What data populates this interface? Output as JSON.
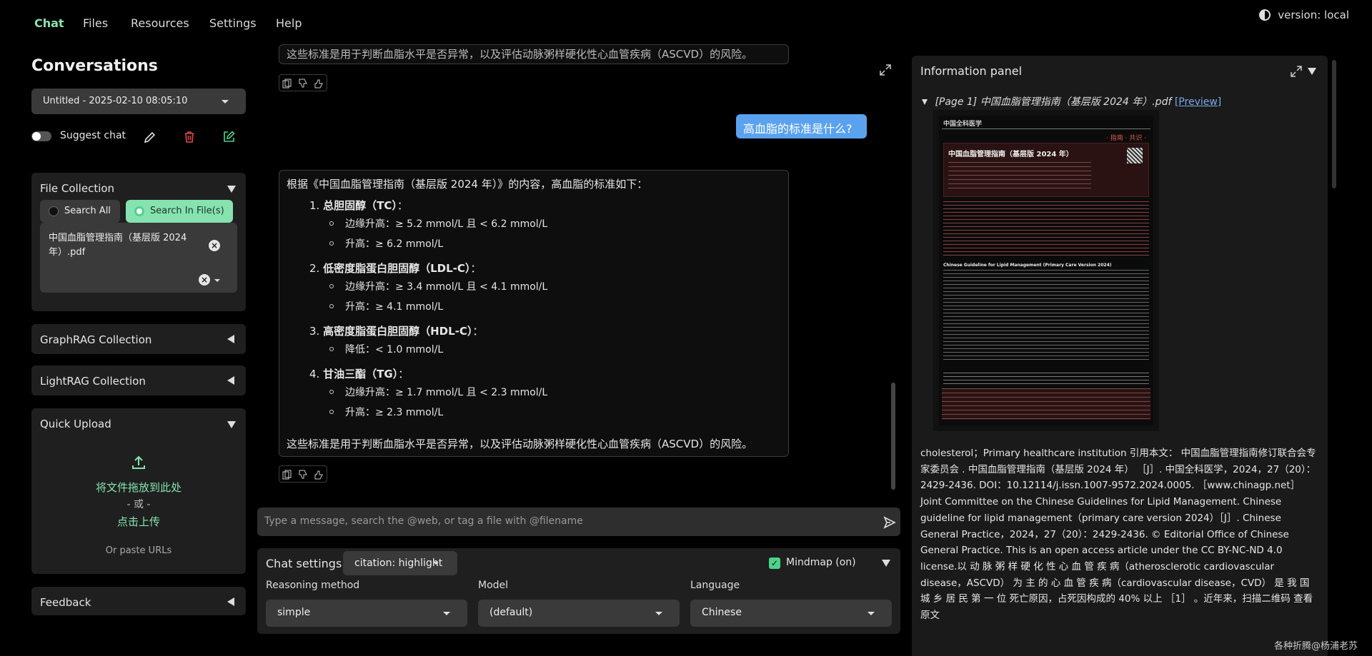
{
  "nav": {
    "items": [
      "Chat",
      "Files",
      "Resources",
      "Settings",
      "Help"
    ],
    "version": "version: local"
  },
  "sidebar": {
    "title": "Conversations",
    "conversation": "Untitled - 2025-02-10 08:05:10",
    "suggest_chat": "Suggest chat",
    "file_collection": {
      "title": "File Collection",
      "search_all": "Search All",
      "search_in_files": "Search In File(s)",
      "selected_file": "中国血脂管理指南（基层版 2024 年）.pdf"
    },
    "graphrag": "GraphRAG Collection",
    "lightrag": "LightRAG Collection",
    "quick_upload": {
      "title": "Quick Upload",
      "drop_text": "将文件拖放到此处",
      "or_text": "- 或 -",
      "click_upload": "点击上传",
      "paste_urls": "Or paste URLs"
    },
    "feedback": "Feedback"
  },
  "chat": {
    "previous_tail": "这些标准是用于判断血脂水平是否异常，以及评估动脉粥样硬化性心血管疾病（ASCVD）的风险。",
    "user_message": "高血脂的标准是什么?",
    "answer": {
      "intro": "根据《中国血脂管理指南（基层版 2024 年）》的内容，高血脂的标准如下：",
      "items": [
        {
          "num": "1.",
          "title": "总胆固醇（TC）",
          "colon": "：",
          "subs": [
            "边缘升高：≥ 5.2 mmol/L 且 < 6.2 mmol/L",
            "升高：≥ 6.2 mmol/L"
          ]
        },
        {
          "num": "2.",
          "title": "低密度脂蛋白胆固醇（LDL-C）",
          "colon": "：",
          "subs": [
            "边缘升高：≥ 3.4 mmol/L 且 < 4.1 mmol/L",
            "升高：≥ 4.1 mmol/L"
          ]
        },
        {
          "num": "3.",
          "title": "高密度脂蛋白胆固醇（HDL-C）",
          "colon": "：",
          "subs": [
            "降低：< 1.0 mmol/L"
          ]
        },
        {
          "num": "4.",
          "title": "甘油三酯（TG）",
          "colon": "：",
          "subs": [
            "边缘升高：≥ 1.7 mmol/L 且 < 2.3 mmol/L",
            "升高：≥ 2.3 mmol/L"
          ]
        }
      ],
      "conclusion": "这些标准是用于判断血脂水平是否异常，以及评估动脉粥样硬化性心血管疾病（ASCVD）的风险。"
    },
    "input_placeholder": "Type a message, search the @web, or tag a file with @filename"
  },
  "chat_settings": {
    "title": "Chat settings",
    "citation": "citation: highlight",
    "mindmap": "Mindmap (on)",
    "reasoning_label": "Reasoning method",
    "reasoning_value": "simple",
    "model_label": "Model",
    "model_value": "(default)",
    "language_label": "Language",
    "language_value": "Chinese"
  },
  "info_panel": {
    "title": "Information panel",
    "page_ref": "[Page 1] 中国血脂管理指南（基层版 2024 年）.pdf",
    "preview_link": "[Preview]",
    "doc_header": "中国全科医学",
    "doc_tag": "· 指南 · 共识 ·",
    "doc_title": "中国血脂管理指南（基层版 2024 年）",
    "doc_en_title": "Chinese Guideline for Lipid Management (Primary Care Version 2024)",
    "text": "cholesterol；Primary healthcare institution 引用本文： 中国血脂管理指南修订联合会专家委员会 . 中国血脂管理指南（基层版 2024 年） ［J］. 中国全科医学，2024，27（20）：2429-2436. DOI：10.12114/j.issn.1007-9572.2024.0005. ［www.chinagp.net］ Joint Committee on the Chinese Guidelines for Lipid Management. Chinese guideline for lipid management（primary care version 2024）［J］. Chinese General Practice，2024，27（20）：2429-2436. © Editorial Office of Chinese General Practice. This is an open access article under the CC BY-NC-ND 4.0 license.以 动 脉 粥 样 硬 化 性 心 血 管 疾 病（atherosclerotic cardiovascular disease，ASCVD） 为 主 的 心 血 管 疾 病（cardiovascular disease，CVD） 是 我 国 城 乡 居 民 第 一 位 死亡原因，占死因构成的 40% 以上 ［1］ 。近年来，扫描二维码 查看原文"
  },
  "watermark": "各种折腾@杨浦老苏",
  "colors": {
    "accent_green": "#86e3b0",
    "user_bubble": "#5aa2ee",
    "delete_red": "#e04848"
  }
}
